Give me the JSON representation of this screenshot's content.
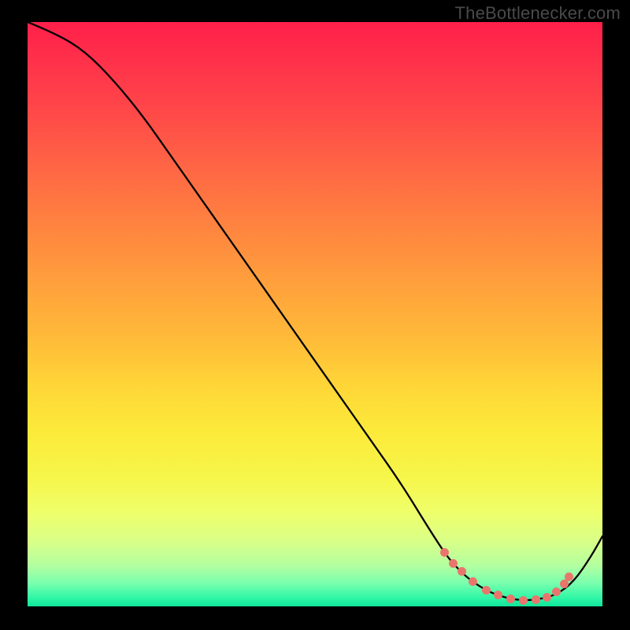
{
  "watermark": "TheBottlenecker.com",
  "chart_data": {
    "type": "line",
    "title": "",
    "xlabel": "",
    "ylabel": "",
    "xlim": [
      0,
      100
    ],
    "ylim": [
      0,
      100
    ],
    "grid": false,
    "series": [
      {
        "name": "bottleneck-curve",
        "x": [
          0,
          5,
          10,
          15,
          20,
          25,
          30,
          35,
          40,
          45,
          50,
          55,
          60,
          65,
          70,
          73,
          75,
          77,
          80,
          83,
          86,
          89,
          92,
          95,
          98,
          100
        ],
        "values": [
          100,
          98,
          95,
          90,
          84,
          77,
          70,
          63,
          56,
          49,
          42,
          35,
          28,
          21,
          13,
          8.5,
          6.3,
          4.5,
          2.6,
          1.5,
          1.0,
          1.2,
          2.0,
          4.2,
          8.5,
          12
        ]
      }
    ],
    "markers": {
      "name": "optimal-zone",
      "x": [
        72.5,
        74.0,
        75.5,
        77.5,
        79.8,
        81.8,
        84.0,
        86.2,
        88.4,
        90.3,
        92.0,
        93.3,
        94.2
      ],
      "values": [
        9.2,
        7.3,
        6.0,
        4.3,
        2.8,
        1.9,
        1.3,
        1.0,
        1.1,
        1.6,
        2.5,
        3.8,
        5.0
      ]
    }
  }
}
